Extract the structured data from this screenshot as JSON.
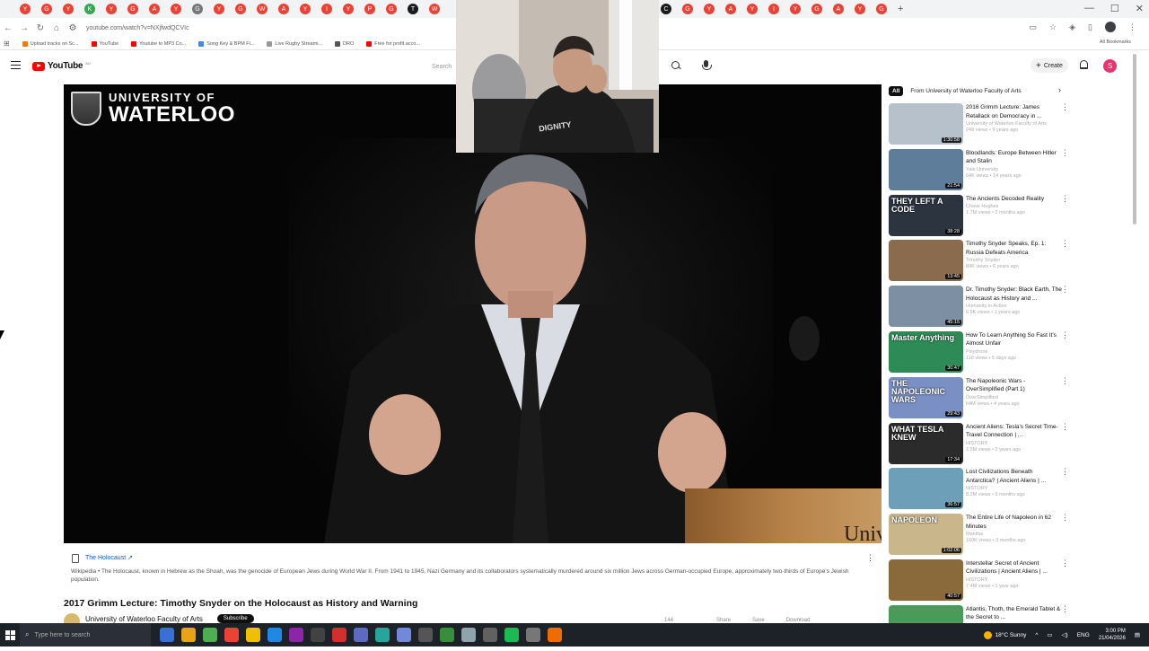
{
  "browser": {
    "tabs": [
      {
        "color": "#ea4335",
        "glyph": "Y"
      },
      {
        "color": "#ea4335",
        "glyph": "G"
      },
      {
        "color": "#ea4335",
        "glyph": "Y"
      },
      {
        "color": "#34a853",
        "glyph": "K"
      },
      {
        "color": "#ea4335",
        "glyph": "Y"
      },
      {
        "color": "#ea4335",
        "glyph": "G"
      },
      {
        "color": "#ea4335",
        "glyph": "A"
      },
      {
        "color": "#ea4335",
        "glyph": "Y"
      },
      {
        "color": "#777777",
        "glyph": "G"
      },
      {
        "color": "#ea4335",
        "glyph": "Y"
      },
      {
        "color": "#ea4335",
        "glyph": "G"
      },
      {
        "color": "#ea4335",
        "glyph": "W"
      },
      {
        "color": "#ea4335",
        "glyph": "A"
      },
      {
        "color": "#ea4335",
        "glyph": "Y"
      },
      {
        "color": "#ea4335",
        "glyph": "I"
      },
      {
        "color": "#ea4335",
        "glyph": "Y"
      },
      {
        "color": "#ea4335",
        "glyph": "P"
      },
      {
        "color": "#ea4335",
        "glyph": "G"
      },
      {
        "color": "#1a1a1a",
        "glyph": "T"
      },
      {
        "color": "#ea4335",
        "glyph": "W"
      }
    ],
    "tabs_right": [
      {
        "color": "#ea4335",
        "glyph": "P"
      },
      {
        "color": "#1a1a1a",
        "glyph": "C"
      },
      {
        "color": "#ea4335",
        "glyph": "G"
      },
      {
        "color": "#ea4335",
        "glyph": "Y"
      },
      {
        "color": "#ea4335",
        "glyph": "A"
      },
      {
        "color": "#ea4335",
        "glyph": "Y"
      },
      {
        "color": "#ea4335",
        "glyph": "I"
      },
      {
        "color": "#ea4335",
        "glyph": "Y"
      },
      {
        "color": "#ea4335",
        "glyph": "G"
      },
      {
        "color": "#ea4335",
        "glyph": "A"
      },
      {
        "color": "#ea4335",
        "glyph": "Y"
      },
      {
        "color": "#ea4335",
        "glyph": "G"
      }
    ],
    "url": "youtube.com/watch?v=NXjfwdQCVIc",
    "bookmarks": [
      {
        "label": "Upload tracks on Sc...",
        "color": "#ff7700"
      },
      {
        "label": "YouTube",
        "color": "#ff0000"
      },
      {
        "label": "Youtube to MP3 Co...",
        "color": "#ff0000"
      },
      {
        "label": "Song Key & BPM Fi...",
        "color": "#4285f4"
      },
      {
        "label": "Live Rugby Streami...",
        "color": "#999999"
      },
      {
        "label": "DRO",
        "color": "#555555"
      },
      {
        "label": "Free for profit acco...",
        "color": "#ff0000"
      }
    ],
    "all_bookmarks": "All Bookmarks"
  },
  "youtube": {
    "logo_text": "YouTube",
    "logo_country": "AU",
    "search_placeholder": "Search",
    "create_label": "Create",
    "avatar_letter": "S"
  },
  "player": {
    "logo_line1": "UNIVERSITY OF",
    "logo_line2": "WATERLOO",
    "podium_text": "Univ"
  },
  "wiki_panel": {
    "title": "The Holocaust",
    "text": "Wikipedia • The Holocaust, known in Hebrew as the Shoah, was the genocide of European Jews during World War II. From 1941 to 1945, Nazi Germany and its collaborators systematically murdered around six million Jews across German-occupied Europe, approximately two-thirds of Europe's Jewish population."
  },
  "video": {
    "title": "2017 Grimm Lecture: Timothy Snyder on the Holocaust as History and Warning",
    "channel": "University of Waterloo Faculty of Arts",
    "subscribe": "Subscribe",
    "actions": [
      "144",
      "",
      "Share",
      "Save",
      "Download"
    ]
  },
  "chips": {
    "all": "All",
    "from_channel": "From University of Waterloo Faculty of Arts"
  },
  "recommendations": [
    {
      "title": "2016 Grimm Lecture: James Retallack on Democracy in ...",
      "channel": "University of Waterloo Faculty of Arts",
      "meta": "248 views • 9 years ago",
      "duration": "1:30:58",
      "thumb_label": "",
      "bg": "#b7c1cc"
    },
    {
      "title": "Bloodlands: Europe Between Hitler and Stalin",
      "channel": "Yale University",
      "meta": "64K views • 14 years ago",
      "duration": "21:54",
      "thumb_label": "",
      "bg": "#5d7d9a"
    },
    {
      "title": "The Ancients Decoded Reality",
      "channel": "Chase Hughes",
      "meta": "1.7M views • 2 months ago",
      "duration": "38:28",
      "thumb_label": "THEY LEFT A CODE",
      "bg": "#2c3440"
    },
    {
      "title": "Timothy Snyder Speaks, Ep. 1: Russia Defeats America",
      "channel": "Timothy Snyder",
      "meta": "89K views • 6 years ago",
      "duration": "13:45",
      "thumb_label": "",
      "bg": "#8a6b4e"
    },
    {
      "title": "Dr. Timothy Snyder: Black Earth, The Holocaust as History and ...",
      "channel": "Humanity in Action",
      "meta": "6.5K views • 1 years ago",
      "duration": "45:15",
      "thumb_label": "",
      "bg": "#7d8fa3"
    },
    {
      "title": "How To Learn Anything So Fast It's Almost Unfair",
      "channel": "Pixydrone",
      "meta": "119 views • 5 days ago",
      "duration": "30:47",
      "thumb_label": "Master Anything",
      "bg": "#2e8b57"
    },
    {
      "title": "The Napoleonic Wars - OverSimplified (Part 1)",
      "channel": "OverSimplified",
      "meta": "64M views • 4 years ago",
      "duration": "29:43",
      "thumb_label": "THE NAPOLEONIC WARS",
      "bg": "#7a8fc4"
    },
    {
      "title": "Ancient Aliens: Tesla's Secret Time-Travel Connection | ...",
      "channel": "HISTORY",
      "meta": "2.5M views • 2 years ago",
      "duration": "17:34",
      "thumb_label": "WHAT TESLA KNEW",
      "bg": "#2b2b2b"
    },
    {
      "title": "Lost Civilizations Beneath Antarctica? | Ancient Aliens | ...",
      "channel": "HISTORY",
      "meta": "8.2M views • 9 months ago",
      "duration": "36:57",
      "thumb_label": "",
      "bg": "#6e9fb8"
    },
    {
      "title": "The Entire Life of Napoleon in 62 Minutes",
      "channel": "Manifas",
      "meta": "150K views • 3 months ago",
      "duration": "1:02:06",
      "thumb_label": "NAPOLEON",
      "bg": "#c9b68a"
    },
    {
      "title": "Interstellar Secret of Ancient Civilizations | Ancient Aliens | ...",
      "channel": "HISTORY",
      "meta": "7.4M views • 1 year ago",
      "duration": "40:57",
      "thumb_label": "",
      "bg": "#8a6a3a"
    },
    {
      "title": "Atlantis, Thoth, the Emerald Tablet & the Secret to ...",
      "channel": "",
      "meta": "",
      "duration": "",
      "thumb_label": "",
      "bg": "#4a9a5a"
    }
  ],
  "taskbar": {
    "search_placeholder": "Type here to search",
    "weather": "18°C  Sunny",
    "lang": "ENG",
    "time": "3:00 PM",
    "date": "21/04/2026",
    "apps": [
      "#3a6fd8",
      "#e8a317",
      "#4caf50",
      "#ea4335",
      "#f0c000",
      "#1e88e5",
      "#8e24aa",
      "#424242",
      "#d32f2f",
      "#5c6bc0",
      "#26a69a",
      "#7289da",
      "#555555",
      "#388e3c",
      "#90a4ae",
      "#616161",
      "#1db954",
      "#777777",
      "#ef6c00"
    ]
  }
}
